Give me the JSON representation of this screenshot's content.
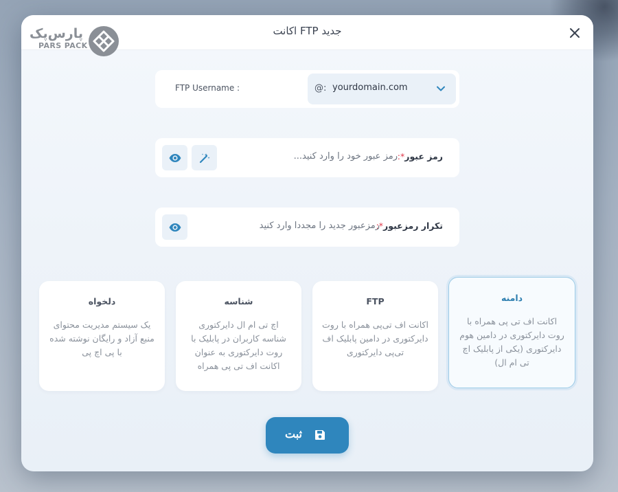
{
  "dialog": {
    "title": "اکانت FTP جدید",
    "close_icon": "close-icon"
  },
  "logo": {
    "text_fa": "پارس‌پک",
    "text_en": "PARS PACK",
    "icon": "pars-pack-logo-icon"
  },
  "username": {
    "label": "FTP Username :",
    "at_sign": "@:",
    "domain_value": "yourdomain.com",
    "chevron_icon": "chevron-down-icon"
  },
  "password": {
    "label": "رمز عبور",
    "required_mark": "*:",
    "placeholder": "رمز عبور خود را وارد کنید...",
    "generate_icon": "magic-wand-icon",
    "show_icon": "eye-icon"
  },
  "confirm_password": {
    "label": "تکرار رمزعبور",
    "required_mark": "*:",
    "placeholder": "رمزعبور جدید را مجددا وارد کنید",
    "show_icon": "eye-icon"
  },
  "options": [
    {
      "title": "دامنه",
      "description": "اکانت اف تی پی همراه با روت دایرکتوری در دامین هوم دایرکتوری (یکی از پابلیک اچ تی ام ال)",
      "selected": true
    },
    {
      "title": "FTP",
      "description": "اکانت اف تی‌پی همراه با روت دایرکتوری در دامین پابلیک اف تی‌پی دایرکتوری",
      "selected": false
    },
    {
      "title": "شناسه",
      "description": "اچ تی ام ال دایرکتوری شناسه کاربران در پابلیک با روت دایرکتوری به عنوان اکانت اف تی پی همراه",
      "selected": false
    },
    {
      "title": "دلخواه",
      "description": "یک سیستم مدیریت محتوای منبع آزاد و رایگان نوشته شده با پی اچ پی",
      "selected": false
    }
  ],
  "submit": {
    "label": "ثبت",
    "icon": "floppy-disk-icon"
  },
  "colors": {
    "accent": "#2f86bd",
    "required": "#e0384b",
    "active_border": "#9ccbe6"
  }
}
